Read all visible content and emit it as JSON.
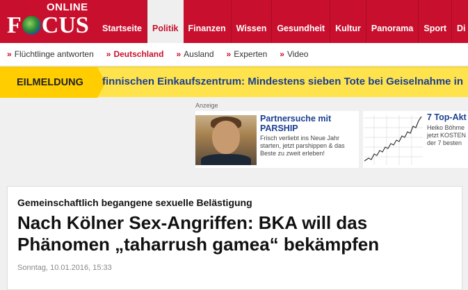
{
  "logo": {
    "top": "ONLINE",
    "main_before": "F",
    "main_after": "CUS"
  },
  "nav": [
    "Startseite",
    "Politik",
    "Finanzen",
    "Wissen",
    "Gesundheit",
    "Kultur",
    "Panorama",
    "Sport",
    "Di"
  ],
  "nav_active_index": 1,
  "subnav": [
    {
      "label": "Flüchtlinge antworten",
      "active": false
    },
    {
      "label": "Deutschland",
      "active": true
    },
    {
      "label": "Ausland",
      "active": false
    },
    {
      "label": "Experten",
      "active": false
    },
    {
      "label": "Video",
      "active": false
    }
  ],
  "subnav_chevron": "»",
  "breaking": {
    "label": "EILMELDUNG",
    "text": "finnischen Einkaufszentrum: Mindestens sieben Tote bei Geiselnahme in"
  },
  "ads": {
    "label": "Anzeige",
    "ad1": {
      "title": "Partnersuche mit PARSHIP",
      "text": "Frisch verliebt ins Neue Jahr starten, jetzt parshippen & das Beste zu zweit erleben!"
    },
    "ad2": {
      "title": "7 Top-Akt",
      "line1": "Heiko Böhme",
      "line2": "jetzt KOSTEN",
      "line3": "der 7 besten"
    }
  },
  "article": {
    "kicker": "Gemeinschaftlich begangene sexuelle Belästigung",
    "headline": "Nach Kölner Sex-Angriffen: BKA will das Phänomen „taharrush gamea“ bekämpfen",
    "date": "Sonntag, 10.01.2016, 15:33"
  },
  "colors": {
    "brand_red": "#c8102e",
    "breaking_yellow": "#ffe34c",
    "link_blue": "#1b3f8f"
  }
}
